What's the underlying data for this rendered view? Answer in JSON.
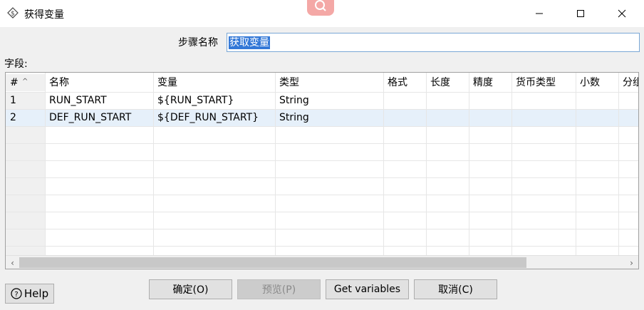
{
  "window": {
    "title": "获得变量",
    "app_icon": "spoon-variable-icon"
  },
  "step_name": {
    "label": "步骤名称",
    "value": "获取变量"
  },
  "fields_label": "字段:",
  "table": {
    "columns": [
      "#",
      "名称",
      "变量",
      "类型",
      "格式",
      "长度",
      "精度",
      "货币类型",
      "小数",
      "分组"
    ],
    "rows": [
      {
        "num": "1",
        "name": "RUN_START",
        "variable": "${RUN_START}",
        "type": "String",
        "format": "",
        "length": "",
        "precision": "",
        "currency": "",
        "decimal": "",
        "group": ""
      },
      {
        "num": "2",
        "name": "DEF_RUN_START",
        "variable": "${DEF_RUN_START}",
        "type": "String",
        "format": "",
        "length": "",
        "precision": "",
        "currency": "",
        "decimal": "",
        "group": ""
      }
    ],
    "selected_row": 2
  },
  "buttons": {
    "ok": "确定(O)",
    "preview": "预览(P)",
    "get_variables": "Get variables",
    "cancel": "取消(C)",
    "help": "Help"
  },
  "colors": {
    "selection": "#3378d7",
    "row_highlight": "#e6f0fa",
    "input_border": "#7aa7d6"
  }
}
